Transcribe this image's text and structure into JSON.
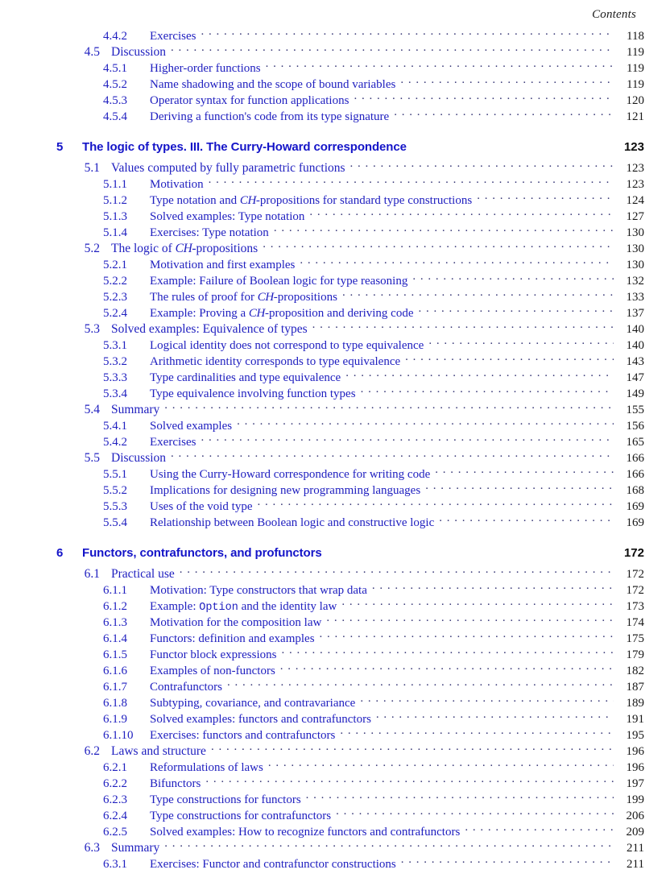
{
  "header": {
    "running_head": "Contents"
  },
  "toc": {
    "entries": [
      {
        "kind": "subsection",
        "num": "4.4.2",
        "title": "Exercises",
        "page": "118"
      },
      {
        "kind": "section",
        "num": "4.5",
        "title": "Discussion",
        "page": "119"
      },
      {
        "kind": "subsection",
        "num": "4.5.1",
        "title": "Higher-order functions",
        "page": "119"
      },
      {
        "kind": "subsection",
        "num": "4.5.2",
        "title": "Name shadowing and the scope of bound variables",
        "page": "119"
      },
      {
        "kind": "subsection",
        "num": "4.5.3",
        "title": "Operator syntax for function applications",
        "page": "120"
      },
      {
        "kind": "subsection",
        "num": "4.5.4",
        "title": "Deriving a function's code from its type signature",
        "page": "121"
      },
      {
        "kind": "chapter",
        "num": "5",
        "title": "The logic of types. III. The Curry-Howard correspondence",
        "page": "123"
      },
      {
        "kind": "section",
        "num": "5.1",
        "title": "Values computed by fully parametric functions",
        "page": "123"
      },
      {
        "kind": "subsection",
        "num": "5.1.1",
        "title": "Motivation",
        "page": "123"
      },
      {
        "kind": "subsection",
        "num": "5.1.2",
        "title": "Type notation and CH-propositions for standard type constructions",
        "html": "Type notation and <span class=\"calli\">CH</span>-propositions for standard type constructions",
        "page": "124"
      },
      {
        "kind": "subsection",
        "num": "5.1.3",
        "title": "Solved examples: Type notation",
        "page": "127"
      },
      {
        "kind": "subsection",
        "num": "5.1.4",
        "title": "Exercises: Type notation",
        "page": "130"
      },
      {
        "kind": "section",
        "num": "5.2",
        "title": "The logic of CH-propositions",
        "html": "The logic of <span class=\"calli\">CH</span>-propositions",
        "page": "130"
      },
      {
        "kind": "subsection",
        "num": "5.2.1",
        "title": "Motivation and first examples",
        "page": "130"
      },
      {
        "kind": "subsection",
        "num": "5.2.2",
        "title": "Example: Failure of Boolean logic for type reasoning",
        "page": "132"
      },
      {
        "kind": "subsection",
        "num": "5.2.3",
        "title": "The rules of proof for CH-propositions",
        "html": "The rules of proof for <span class=\"calli\">CH</span>-propositions",
        "page": "133"
      },
      {
        "kind": "subsection",
        "num": "5.2.4",
        "title": "Example: Proving a CH-proposition and deriving code",
        "html": "Example: Proving a <span class=\"calli\">CH</span>-proposition and deriving code",
        "page": "137"
      },
      {
        "kind": "section",
        "num": "5.3",
        "title": "Solved examples: Equivalence of types",
        "page": "140"
      },
      {
        "kind": "subsection",
        "num": "5.3.1",
        "title": "Logical identity does not correspond to type equivalence",
        "page": "140"
      },
      {
        "kind": "subsection",
        "num": "5.3.2",
        "title": "Arithmetic identity corresponds to type equivalence",
        "page": "143"
      },
      {
        "kind": "subsection",
        "num": "5.3.3",
        "title": "Type cardinalities and type equivalence",
        "page": "147"
      },
      {
        "kind": "subsection",
        "num": "5.3.4",
        "title": "Type equivalence involving function types",
        "page": "149"
      },
      {
        "kind": "section",
        "num": "5.4",
        "title": "Summary",
        "page": "155"
      },
      {
        "kind": "subsection",
        "num": "5.4.1",
        "title": "Solved examples",
        "page": "156"
      },
      {
        "kind": "subsection",
        "num": "5.4.2",
        "title": "Exercises",
        "page": "165"
      },
      {
        "kind": "section",
        "num": "5.5",
        "title": "Discussion",
        "page": "166"
      },
      {
        "kind": "subsection",
        "num": "5.5.1",
        "title": "Using the Curry-Howard correspondence for writing code",
        "page": "166"
      },
      {
        "kind": "subsection",
        "num": "5.5.2",
        "title": "Implications for designing new programming languages",
        "page": "168"
      },
      {
        "kind": "subsection",
        "num": "5.5.3",
        "title": "Uses of the void type",
        "page": "169"
      },
      {
        "kind": "subsection",
        "num": "5.5.4",
        "title": "Relationship between Boolean logic and constructive logic",
        "page": "169"
      },
      {
        "kind": "chapter",
        "num": "6",
        "title": "Functors, contrafunctors, and profunctors",
        "page": "172"
      },
      {
        "kind": "section",
        "num": "6.1",
        "title": "Practical use",
        "page": "172"
      },
      {
        "kind": "subsection",
        "num": "6.1.1",
        "title": "Motivation: Type constructors that wrap data",
        "page": "172"
      },
      {
        "kind": "subsection",
        "num": "6.1.2",
        "title": "Example: Option and the identity law",
        "html": "Example: <span class=\"mono\">Option</span> and the identity law",
        "page": "173"
      },
      {
        "kind": "subsection",
        "num": "6.1.3",
        "title": "Motivation for the composition law",
        "page": "174"
      },
      {
        "kind": "subsection",
        "num": "6.1.4",
        "title": "Functors: definition and examples",
        "page": "175"
      },
      {
        "kind": "subsection",
        "num": "6.1.5",
        "title": "Functor block expressions",
        "page": "179"
      },
      {
        "kind": "subsection",
        "num": "6.1.6",
        "title": "Examples of non-functors",
        "page": "182"
      },
      {
        "kind": "subsection",
        "num": "6.1.7",
        "title": "Contrafunctors",
        "page": "187"
      },
      {
        "kind": "subsection",
        "num": "6.1.8",
        "title": "Subtyping, covariance, and contravariance",
        "page": "189"
      },
      {
        "kind": "subsection",
        "num": "6.1.9",
        "title": "Solved examples: functors and contrafunctors",
        "page": "191"
      },
      {
        "kind": "subsection",
        "num": "6.1.10",
        "title": "Exercises: functors and contrafunctors",
        "page": "195",
        "wide": true
      },
      {
        "kind": "section",
        "num": "6.2",
        "title": "Laws and structure",
        "page": "196"
      },
      {
        "kind": "subsection",
        "num": "6.2.1",
        "title": "Reformulations of laws",
        "page": "196"
      },
      {
        "kind": "subsection",
        "num": "6.2.2",
        "title": "Bifunctors",
        "page": "197"
      },
      {
        "kind": "subsection",
        "num": "6.2.3",
        "title": "Type constructions for functors",
        "page": "199"
      },
      {
        "kind": "subsection",
        "num": "6.2.4",
        "title": "Type constructions for contrafunctors",
        "page": "206"
      },
      {
        "kind": "subsection",
        "num": "6.2.5",
        "title": "Solved examples: How to recognize functors and contrafunctors",
        "page": "209"
      },
      {
        "kind": "section",
        "num": "6.3",
        "title": "Summary",
        "page": "211"
      },
      {
        "kind": "subsection",
        "num": "6.3.1",
        "title": "Exercises: Functor and contrafunctor constructions",
        "page": "211"
      }
    ]
  },
  "colors": {
    "link_blue": "#2020c0",
    "chapter_blue": "#1414c8",
    "page_black": "#181818",
    "leader_dots": "#3a3a78"
  }
}
